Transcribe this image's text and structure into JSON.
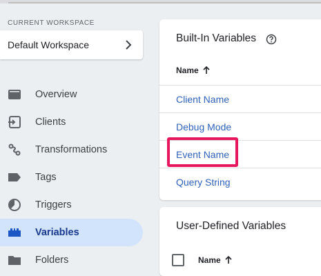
{
  "sidebar": {
    "workspace_label": "CURRENT WORKSPACE",
    "workspace_name": "Default Workspace",
    "items": [
      {
        "label": "Overview",
        "icon": "overview-icon"
      },
      {
        "label": "Clients",
        "icon": "clients-icon"
      },
      {
        "label": "Transformations",
        "icon": "transformations-icon"
      },
      {
        "label": "Tags",
        "icon": "tag-icon"
      },
      {
        "label": "Triggers",
        "icon": "trigger-icon"
      },
      {
        "label": "Variables",
        "icon": "variables-icon",
        "active": true
      },
      {
        "label": "Folders",
        "icon": "folder-icon"
      }
    ]
  },
  "builtin": {
    "title": "Built-In Variables",
    "column_header": "Name",
    "rows": [
      "Client Name",
      "Debug Mode",
      "Event Name",
      "Query String"
    ],
    "highlighted": "Event Name"
  },
  "user_defined": {
    "title": "User-Defined Variables",
    "column_header": "Name"
  },
  "colors": {
    "accent": "#2f62b8",
    "active_bg": "#d2e3fc",
    "highlight": "#e8175d"
  }
}
